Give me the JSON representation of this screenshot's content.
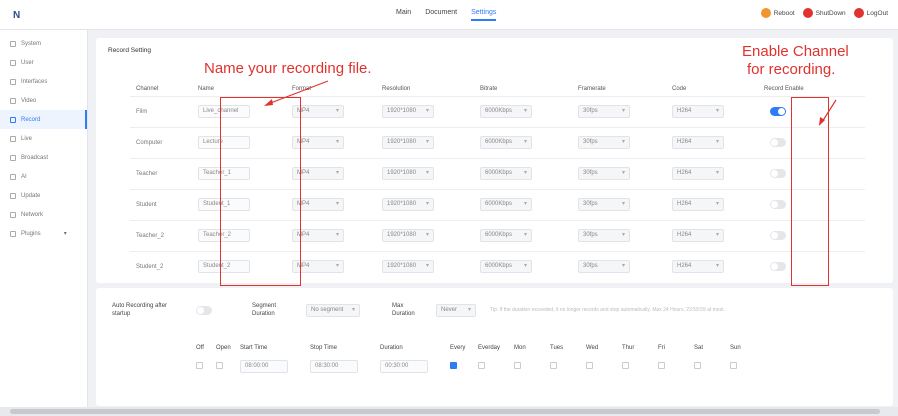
{
  "topbar": {
    "logo_text": "N",
    "nav": [
      "Main",
      "Document",
      "Settings"
    ],
    "active_nav": "Settings",
    "buttons": [
      {
        "label": "Reboot",
        "color": "#f0962f"
      },
      {
        "label": "ShutDown",
        "color": "#e0332f"
      },
      {
        "label": "LogOut",
        "color": "#e0332f"
      }
    ]
  },
  "sidebar": {
    "items": [
      "System",
      "User",
      "Interfaces",
      "Video",
      "Record",
      "Live",
      "Broadcast",
      "AI",
      "Update",
      "Network",
      "Plugins"
    ],
    "active": "Record"
  },
  "record_setting": {
    "title": "Record Setting",
    "headers": [
      "Channel",
      "Name",
      "Format",
      "Resolution",
      "Bitrate",
      "Framerate",
      "Code",
      "Record Enable"
    ],
    "rows": [
      {
        "channel": "Film",
        "name": "Live_channel",
        "format": "MP4",
        "resolution": "1920*1080",
        "bitrate": "6000Kbps",
        "framerate": "30fps",
        "code": "H264",
        "enabled": true
      },
      {
        "channel": "Computer",
        "name": "Lecture",
        "format": "MP4",
        "resolution": "1920*1080",
        "bitrate": "6000Kbps",
        "framerate": "30fps",
        "code": "H264",
        "enabled": false
      },
      {
        "channel": "Teacher",
        "name": "Teacher_1",
        "format": "MP4",
        "resolution": "1920*1080",
        "bitrate": "6000Kbps",
        "framerate": "30fps",
        "code": "H264",
        "enabled": false
      },
      {
        "channel": "Student",
        "name": "Student_1",
        "format": "MP4",
        "resolution": "1920*1080",
        "bitrate": "6000Kbps",
        "framerate": "30fps",
        "code": "H264",
        "enabled": false
      },
      {
        "channel": "Teacher_2",
        "name": "Teacher_2",
        "format": "MP4",
        "resolution": "1920*1080",
        "bitrate": "6000Kbps",
        "framerate": "30fps",
        "code": "H264",
        "enabled": false
      },
      {
        "channel": "Student_2",
        "name": "Student_2",
        "format": "MP4",
        "resolution": "1920*1080",
        "bitrate": "6000Kbps",
        "framerate": "30fps",
        "code": "H264",
        "enabled": false
      }
    ]
  },
  "annotations": {
    "name_note": "Name your recording file.",
    "enable_note_1": "Enable Channel",
    "enable_note_2": "for recording."
  },
  "auto_recording": {
    "label": "Auto Recording after startup",
    "segment_label": "Segment Duration",
    "segment_value": "No segment",
    "max_label": "Max Duration",
    "max_value": "Never",
    "hint": "Tip: If the duration exceeded, it no longer records and stop automatically. Max 24 Hours, 23:59:59 at most."
  },
  "schedule": {
    "headers": [
      "Off",
      "Open",
      "Start Time",
      "Stop Time",
      "Duration",
      "Every",
      "Everday",
      "Mon",
      "Tues",
      "Wed",
      "Thur",
      "Fri",
      "Sat",
      "Sun"
    ],
    "row": {
      "start": "08:00:00",
      "stop": "08:30:00",
      "duration": "00:30:00"
    }
  }
}
